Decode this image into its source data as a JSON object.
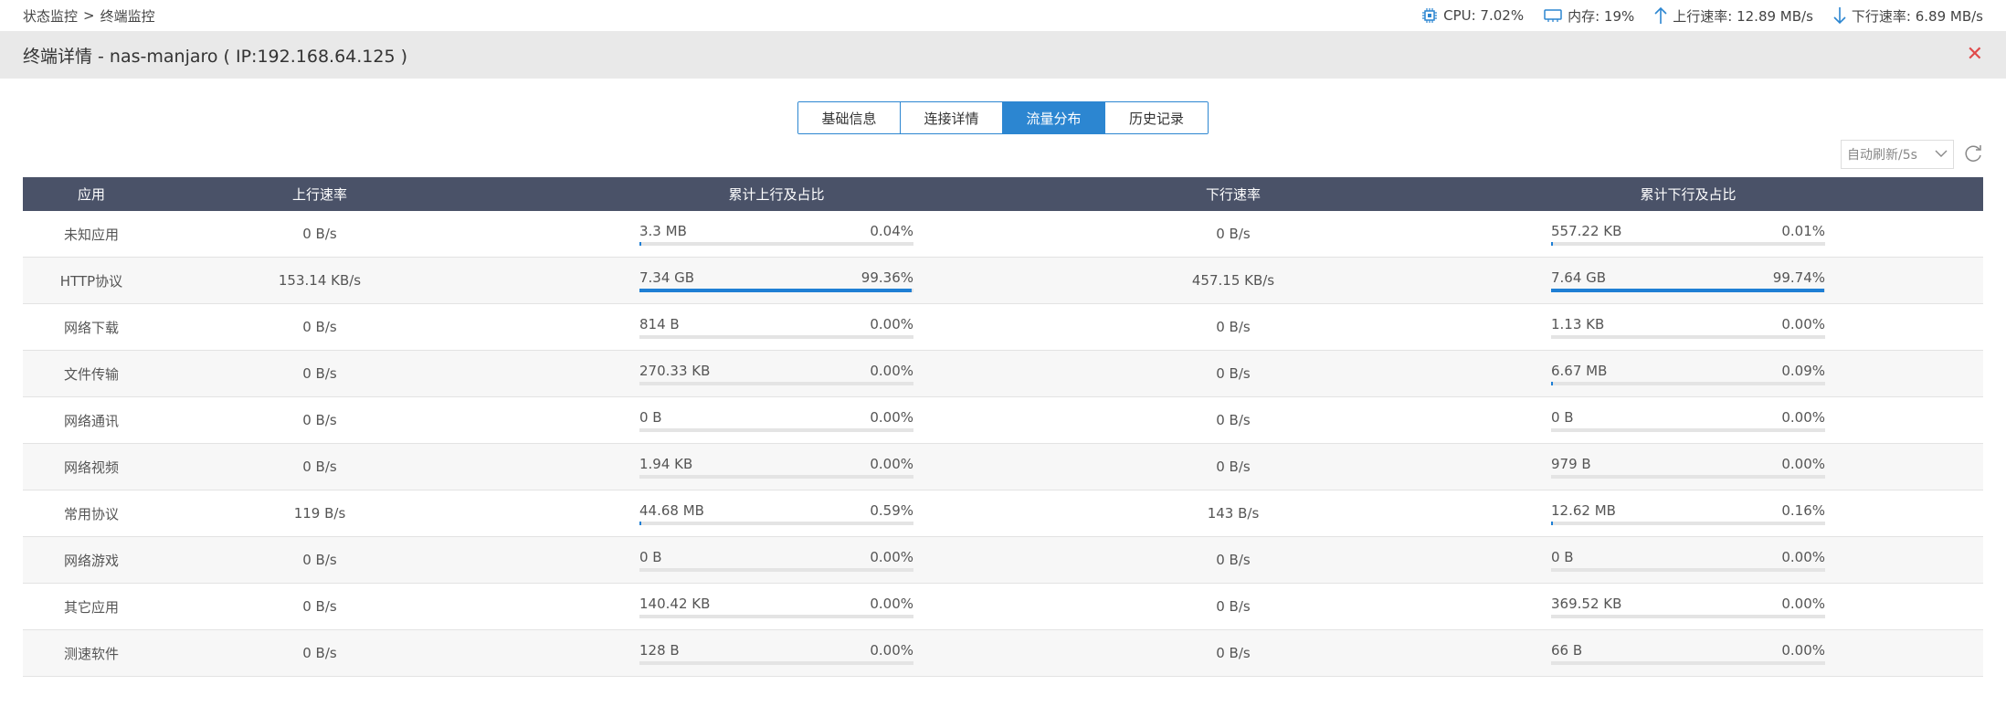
{
  "breadcrumb": {
    "part1": "状态监控",
    "sep": ">",
    "part2": "终端监控"
  },
  "stats": {
    "cpu": "CPU: 7.02%",
    "mem": "内存: 19%",
    "up": "上行速率: 12.89 MB/s",
    "down": "下行速率: 6.89 MB/s"
  },
  "title": "终端详情 - nas-manjaro ( IP:192.168.64.125 )",
  "close": "✕",
  "tabs": [
    "基础信息",
    "连接详情",
    "流量分布",
    "历史记录"
  ],
  "active_tab": 2,
  "refresh_select": "自动刷新/5s",
  "columns": [
    "应用",
    "上行速率",
    "累计上行及占比",
    "下行速率",
    "累计下行及占比"
  ],
  "rows": [
    {
      "app": "未知应用",
      "up": "0 B/s",
      "up_total": "3.3 MB",
      "up_pct": "0.04%",
      "up_frac": 0.0004,
      "down": "0 B/s",
      "down_total": "557.22 KB",
      "down_pct": "0.01%",
      "down_frac": 0.0001
    },
    {
      "app": "HTTP协议",
      "up": "153.14 KB/s",
      "up_total": "7.34 GB",
      "up_pct": "99.36%",
      "up_frac": 0.9936,
      "down": "457.15 KB/s",
      "down_total": "7.64 GB",
      "down_pct": "99.74%",
      "down_frac": 0.9974
    },
    {
      "app": "网络下载",
      "up": "0 B/s",
      "up_total": "814 B",
      "up_pct": "0.00%",
      "up_frac": 0,
      "down": "0 B/s",
      "down_total": "1.13 KB",
      "down_pct": "0.00%",
      "down_frac": 0
    },
    {
      "app": "文件传输",
      "up": "0 B/s",
      "up_total": "270.33 KB",
      "up_pct": "0.00%",
      "up_frac": 0,
      "down": "0 B/s",
      "down_total": "6.67 MB",
      "down_pct": "0.09%",
      "down_frac": 0.0009
    },
    {
      "app": "网络通讯",
      "up": "0 B/s",
      "up_total": "0 B",
      "up_pct": "0.00%",
      "up_frac": 0,
      "down": "0 B/s",
      "down_total": "0 B",
      "down_pct": "0.00%",
      "down_frac": 0
    },
    {
      "app": "网络视频",
      "up": "0 B/s",
      "up_total": "1.94 KB",
      "up_pct": "0.00%",
      "up_frac": 0,
      "down": "0 B/s",
      "down_total": "979 B",
      "down_pct": "0.00%",
      "down_frac": 0
    },
    {
      "app": "常用协议",
      "up": "119 B/s",
      "up_total": "44.68 MB",
      "up_pct": "0.59%",
      "up_frac": 0.0059,
      "down": "143 B/s",
      "down_total": "12.62 MB",
      "down_pct": "0.16%",
      "down_frac": 0.0016
    },
    {
      "app": "网络游戏",
      "up": "0 B/s",
      "up_total": "0 B",
      "up_pct": "0.00%",
      "up_frac": 0,
      "down": "0 B/s",
      "down_total": "0 B",
      "down_pct": "0.00%",
      "down_frac": 0
    },
    {
      "app": "其它应用",
      "up": "0 B/s",
      "up_total": "140.42 KB",
      "up_pct": "0.00%",
      "up_frac": 0,
      "down": "0 B/s",
      "down_total": "369.52 KB",
      "down_pct": "0.00%",
      "down_frac": 0
    },
    {
      "app": "测速软件",
      "up": "0 B/s",
      "up_total": "128 B",
      "up_pct": "0.00%",
      "up_frac": 0,
      "down": "0 B/s",
      "down_total": "66 B",
      "down_pct": "0.00%",
      "down_frac": 0
    }
  ],
  "colors": {
    "accent": "#2c86d1",
    "header_bg": "#4a5268",
    "close": "#e04a4a",
    "bar": "#1f7fd4"
  },
  "icons": [
    "cpu-icon",
    "memory-icon",
    "arrow-up-icon",
    "arrow-down-icon",
    "close-icon",
    "chevron-down-icon",
    "refresh-icon"
  ]
}
